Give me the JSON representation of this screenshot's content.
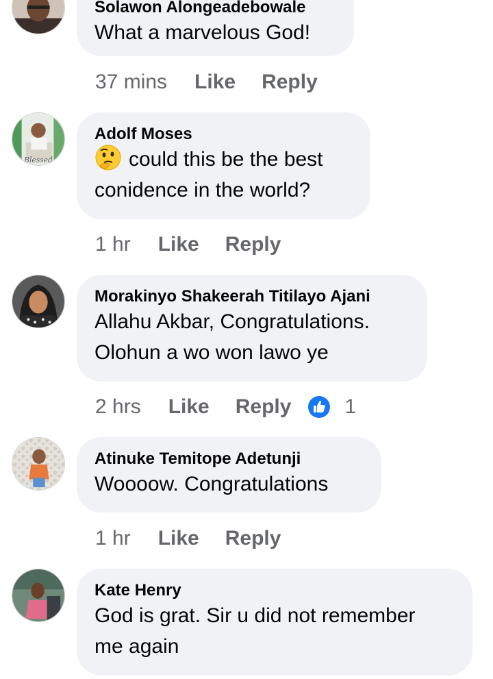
{
  "comments": [
    {
      "author": "Solawon Alongeadebowale",
      "lines": [
        "What a marvelous God!"
      ],
      "time": "37 mins",
      "like_label": "Like",
      "reply_label": "Reply"
    },
    {
      "author": "Adolf Moses",
      "emoji": "thinking-face",
      "lines": [
        "could this be the best",
        "conidence in the world?"
      ],
      "time": "1 hr",
      "like_label": "Like",
      "reply_label": "Reply"
    },
    {
      "author": "Morakinyo Shakeerah Titilayo Ajani",
      "lines": [
        "Allahu Akbar, Congratulations.",
        "Olohun a wo won lawo ye"
      ],
      "time": "2 hrs",
      "like_label": "Like",
      "reply_label": "Reply",
      "reaction_count": "1",
      "reaction_icon": "thumbs-up-icon"
    },
    {
      "author": "Atinuke Temitope Adetunji",
      "lines": [
        "Woooow. Congratulations"
      ],
      "time": "1 hr",
      "like_label": "Like",
      "reply_label": "Reply"
    },
    {
      "author": "Kate Henry",
      "lines": [
        "God is grat. Sir u did not remember",
        "me again"
      ]
    }
  ],
  "colors": {
    "bubble": "#f0f2f5",
    "meta_text": "#65676b",
    "like_blue": "#1877f2"
  }
}
